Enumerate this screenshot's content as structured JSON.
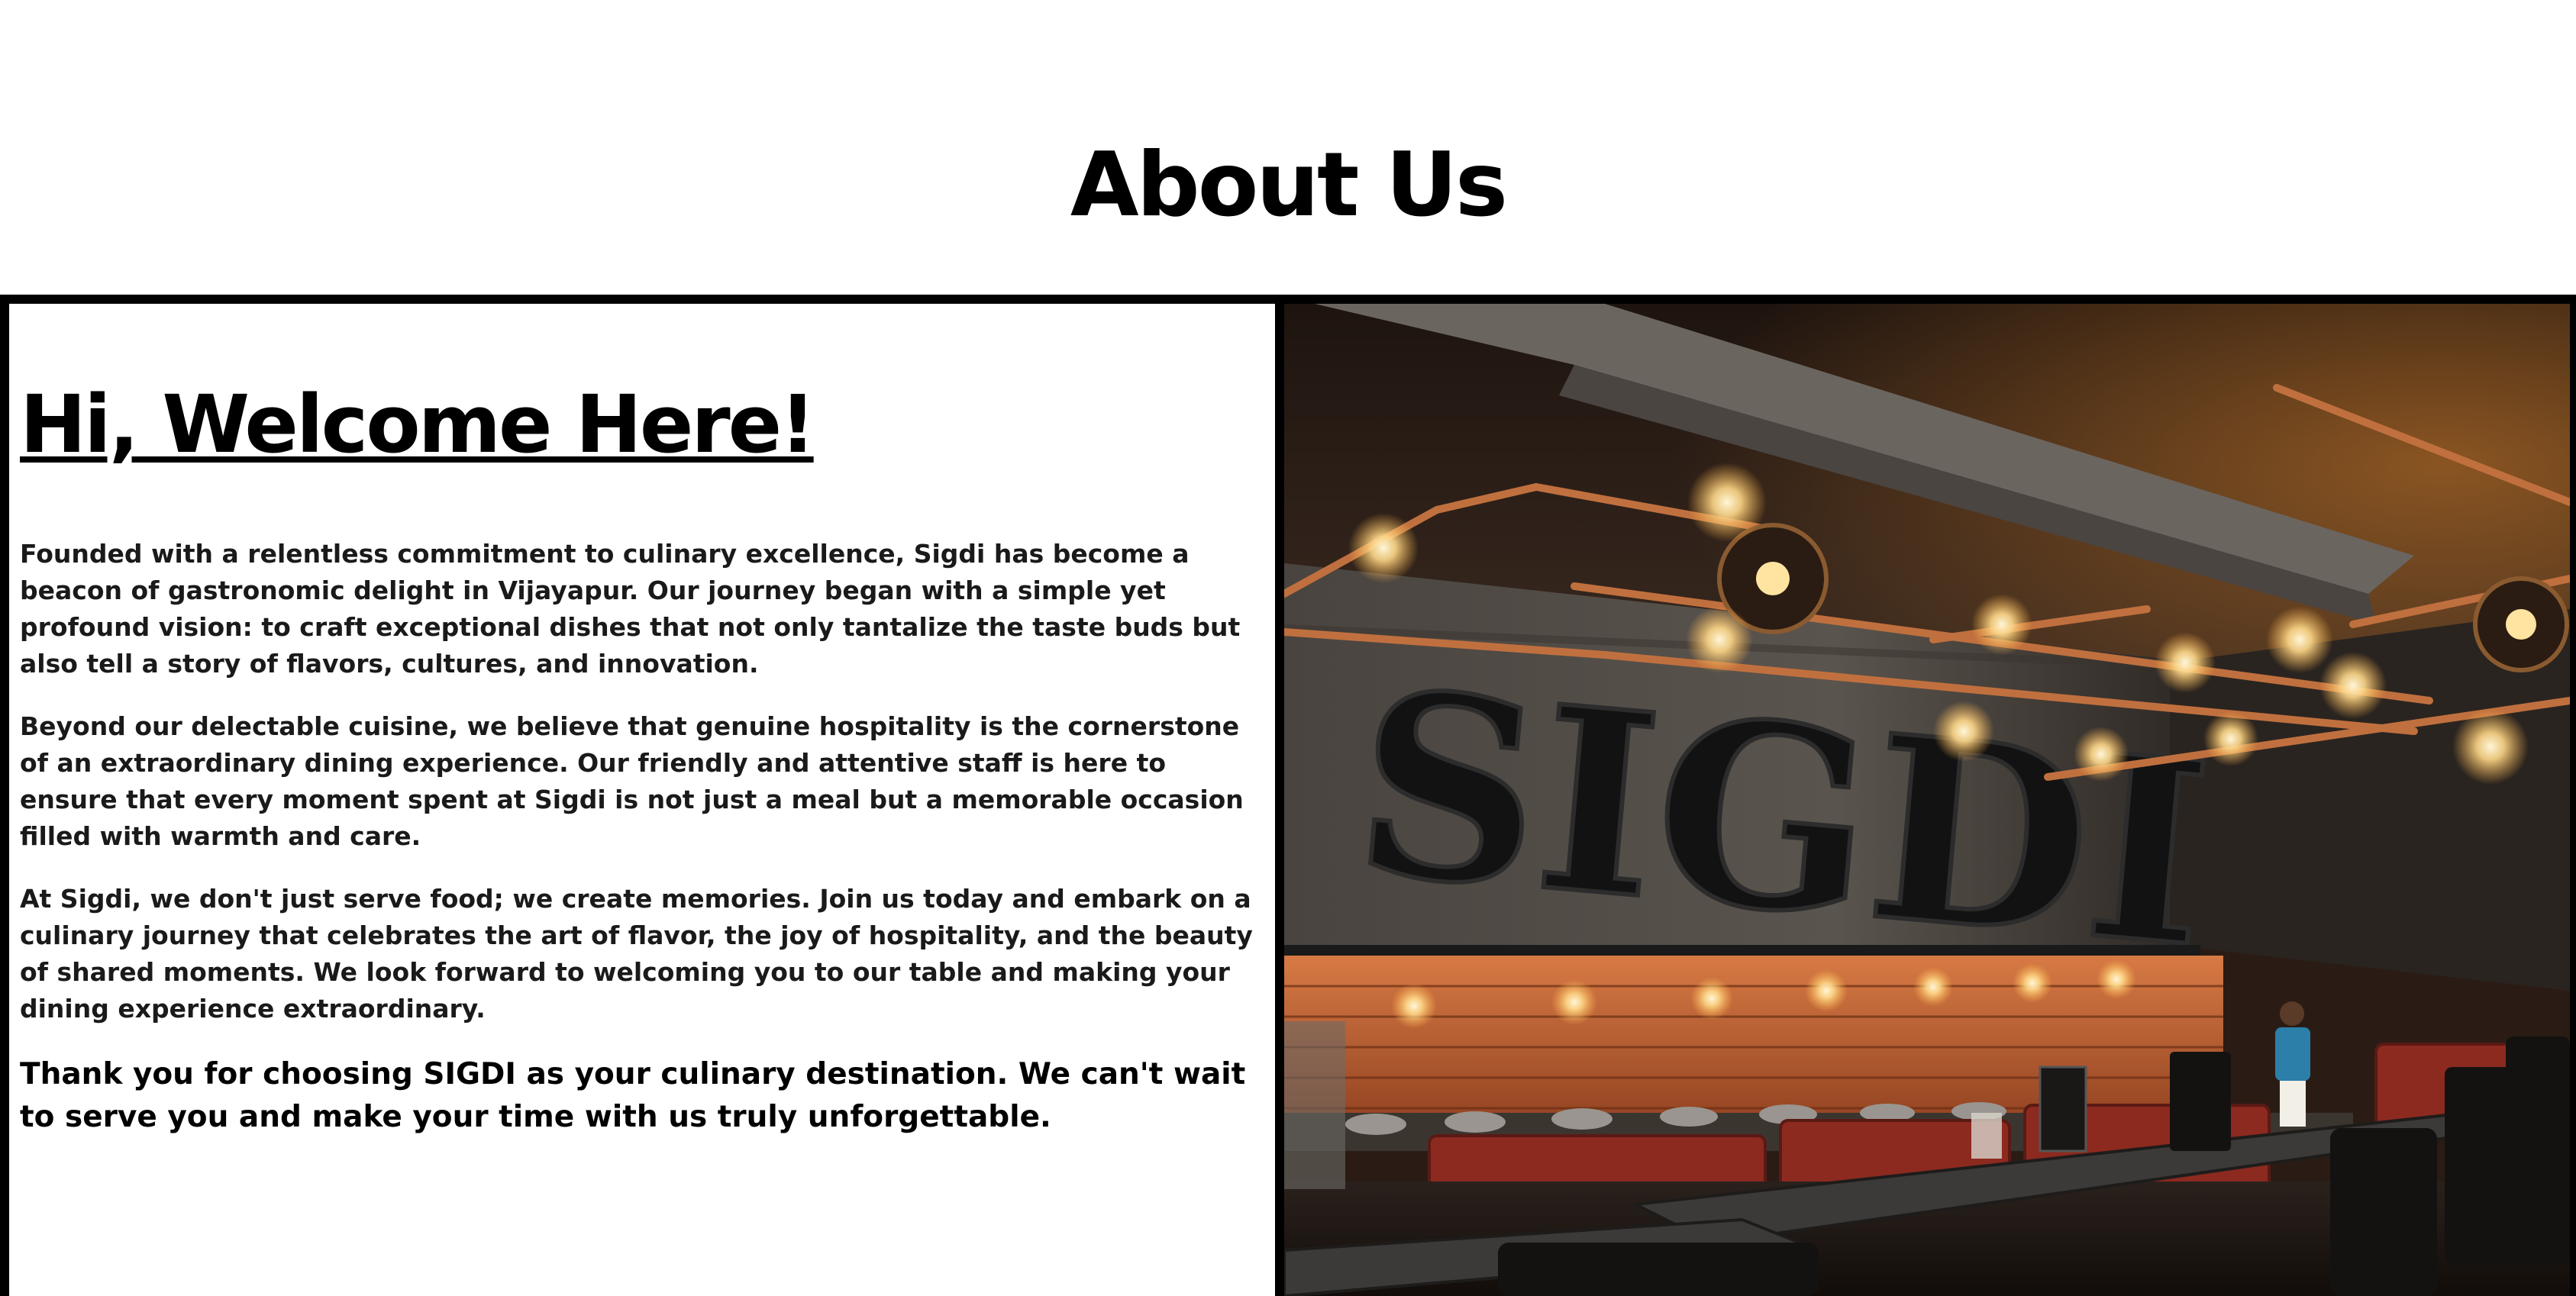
{
  "page": {
    "title": "About Us"
  },
  "about": {
    "heading": "Hi, Welcome Here!",
    "paragraphs": [
      "Founded with a relentless commitment to culinary excellence, Sigdi has become a beacon of gastronomic delight in Vijayapur. Our journey began with a simple yet profound vision: to craft exceptional dishes that not only tantalize the taste buds but also tell a story of flavors, cultures, and innovation.",
      "Beyond our delectable cuisine, we believe that genuine hospitality is the cornerstone of an extraordinary dining experience. Our friendly and attentive staff is here to ensure that every moment spent at Sigdi is not just a meal but a memorable occasion filled with warmth and care.",
      "At Sigdi, we don't just serve food; we create memories. Join us today and embark on a culinary journey that celebrates the art of flavor, the joy of hospitality, and the beauty of shared moments. We look forward to welcoming you to our table and making your dining experience extraordinary."
    ],
    "closing": "Thank you for choosing SIGDI as your culinary destination. We can't wait to serve you and make your time with us truly unforgettable."
  },
  "photo": {
    "sign_text": "SIGDI"
  },
  "colors": {
    "text": "#000000",
    "border": "#000000",
    "background": "#ffffff"
  }
}
